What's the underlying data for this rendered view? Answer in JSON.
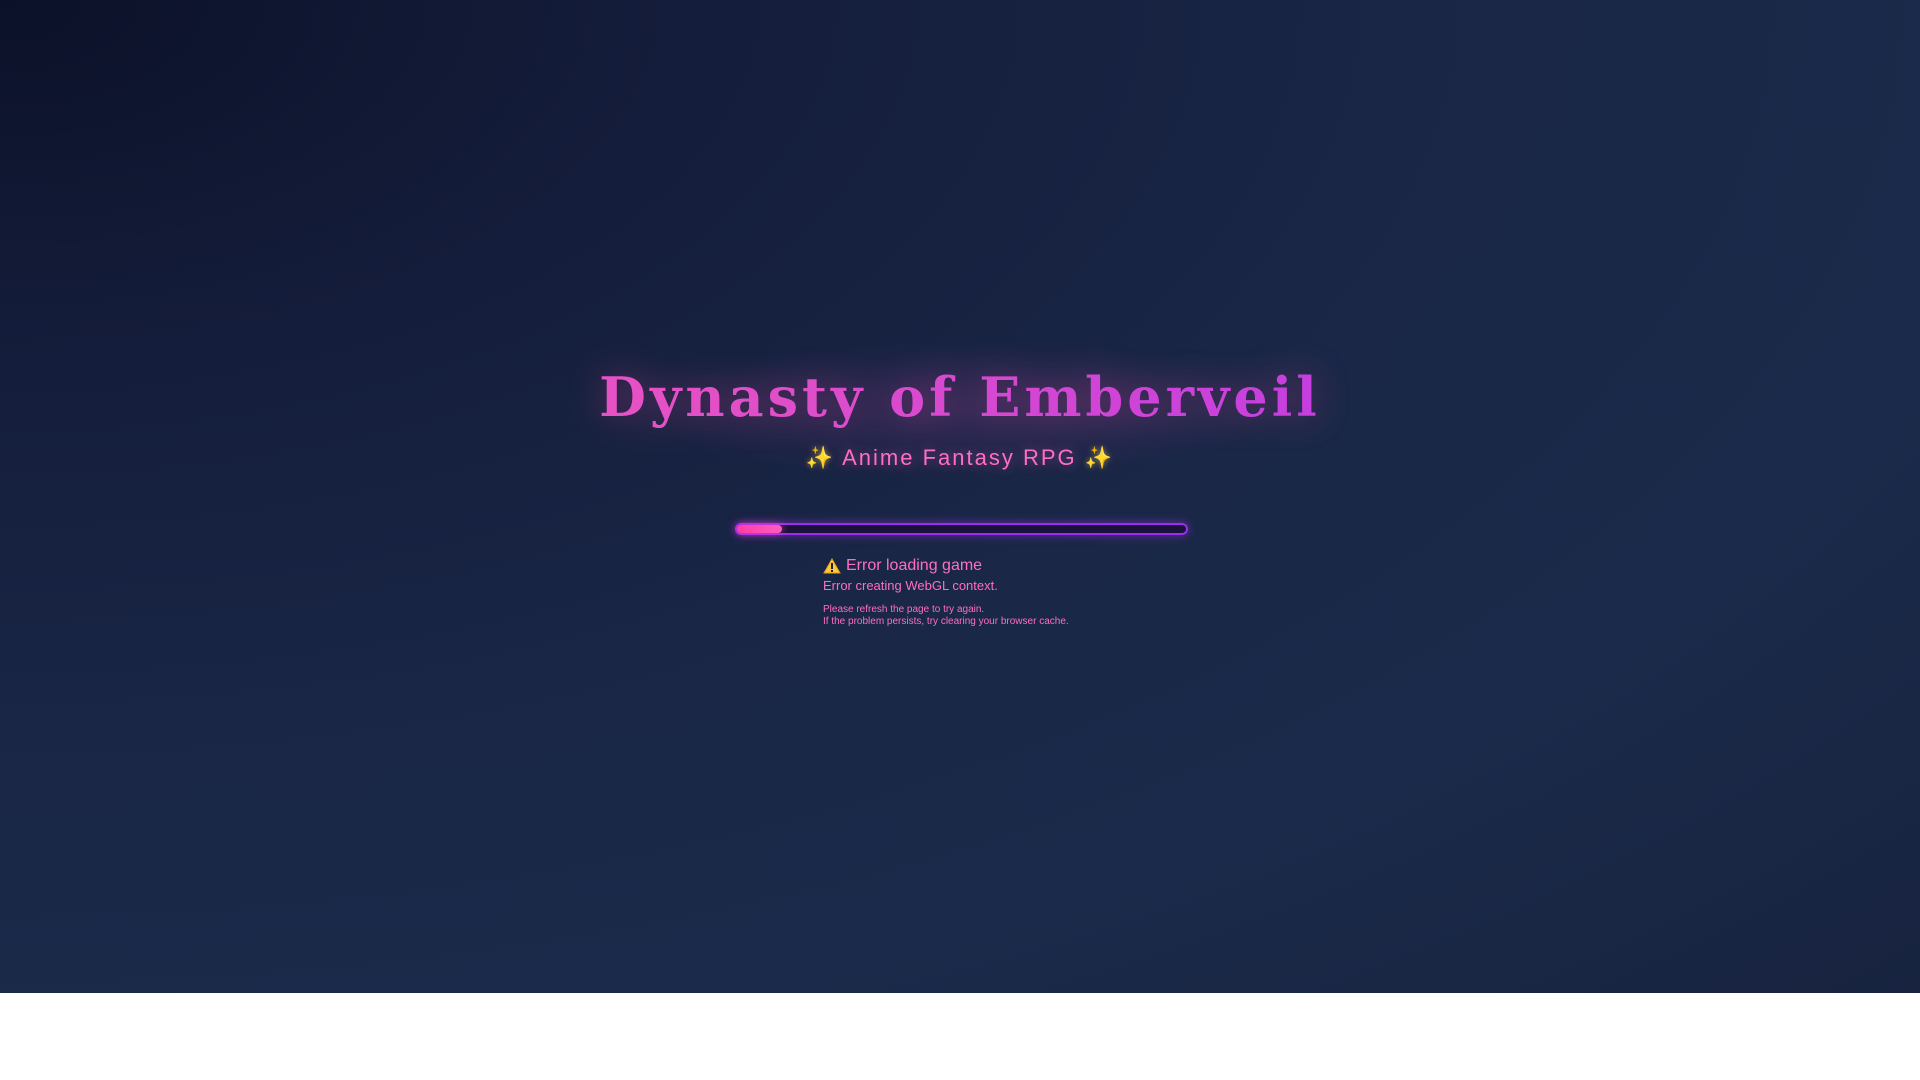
{
  "game": {
    "title": "Dynasty of Emberveil",
    "subtitle": "Anime Fantasy RPG",
    "subtitle_prefix": "✨",
    "subtitle_suffix": "✨"
  },
  "loading": {
    "progress_fraction": 0.1
  },
  "error": {
    "icon": "warning-icon",
    "title": "Error loading game",
    "message": "Error creating WebGL context.",
    "hint_line1": "Please refresh the page to try again.",
    "hint_line2": "If the problem persists, try clearing your browser cache."
  },
  "colors": {
    "accent_pink": "#ff6ec0",
    "accent_purple": "#9b2cf5",
    "warning_yellow": "#ffd34d"
  }
}
